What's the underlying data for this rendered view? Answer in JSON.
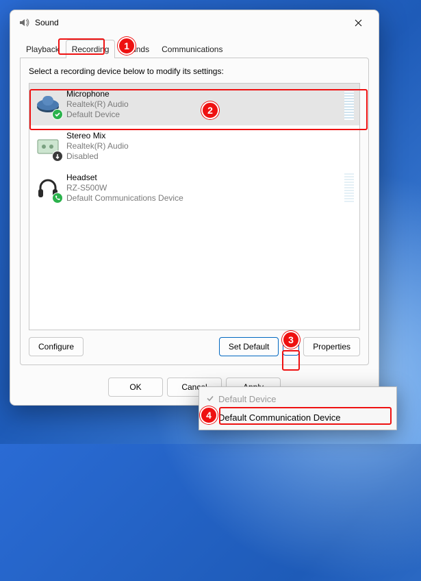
{
  "window": {
    "title": "Sound"
  },
  "tabs": {
    "playback": "Playback",
    "recording": "Recording",
    "sounds": "Sounds",
    "communications": "Communications",
    "active": "recording"
  },
  "panel": {
    "instruction": "Select a recording device below to modify its settings:",
    "devices": [
      {
        "name": "Microphone",
        "driver": "Realtek(R) Audio",
        "status": "Default Device",
        "selected": true,
        "icon": "microphone",
        "badge": "check"
      },
      {
        "name": "Stereo Mix",
        "driver": "Realtek(R) Audio",
        "status": "Disabled",
        "selected": false,
        "icon": "soundcard",
        "badge": "down"
      },
      {
        "name": "Headset",
        "driver": "RZ-S500W",
        "status": "Default Communications Device",
        "selected": false,
        "icon": "headset",
        "badge": "phone"
      }
    ],
    "buttons": {
      "configure": "Configure",
      "set_default": "Set Default",
      "properties": "Properties"
    }
  },
  "dialog_buttons": {
    "ok": "OK",
    "cancel": "Cancel",
    "apply": "Apply"
  },
  "menu": {
    "default_device": "Default Device",
    "default_comm": "Default Communication Device"
  },
  "callouts": {
    "c1": "1",
    "c2": "2",
    "c3": "3",
    "c4": "4"
  }
}
